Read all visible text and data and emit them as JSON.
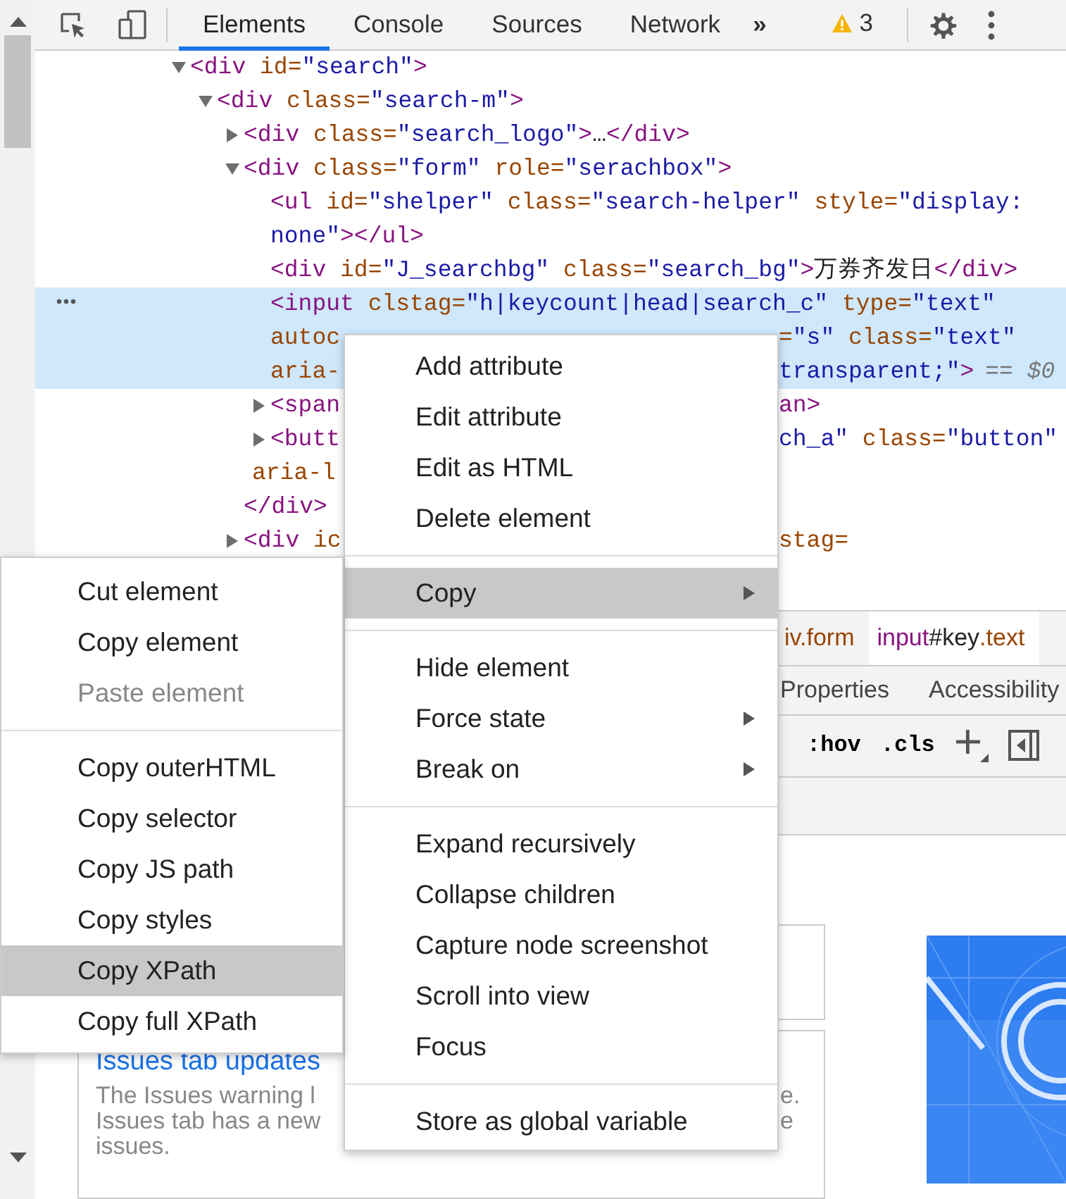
{
  "toolbar": {
    "tabs": [
      {
        "label": "Elements",
        "selected": true
      },
      {
        "label": "Console",
        "selected": false
      },
      {
        "label": "Sources",
        "selected": false
      },
      {
        "label": "Network",
        "selected": false
      }
    ],
    "overflow": "»",
    "warning_count": "3"
  },
  "dom_tree": [
    {
      "expanded": true,
      "selected": false,
      "lines": [
        [
          [
            {
              "kind": "tag",
              "text": "<div"
            },
            {
              "kind": "attr",
              "text": " id="
            },
            {
              "kind": "value",
              "text": "\"search\""
            },
            {
              "kind": "tag",
              "text": ">"
            }
          ]
        ]
      ],
      "children": [
        {
          "expanded": true,
          "selected": false,
          "lines": [
            [
              [
                {
                  "kind": "tag",
                  "text": "<div"
                },
                {
                  "kind": "attr",
                  "text": " class="
                },
                {
                  "kind": "value",
                  "text": "\"search-m\""
                },
                {
                  "kind": "tag",
                  "text": ">"
                }
              ]
            ]
          ],
          "children": [
            {
              "expanded": false,
              "selected": false,
              "lines": [
                [
                  [
                    {
                      "kind": "tag",
                      "text": "<div"
                    },
                    {
                      "kind": "attr",
                      "text": " class="
                    },
                    {
                      "kind": "value",
                      "text": "\"search_logo\""
                    },
                    {
                      "kind": "tag",
                      "text": ">"
                    },
                    {
                      "kind": "text",
                      "text": "…"
                    },
                    {
                      "kind": "tag",
                      "text": "</div>"
                    }
                  ]
                ]
              ]
            },
            {
              "expanded": true,
              "selected": false,
              "lines": [
                [
                  [
                    {
                      "kind": "tag",
                      "text": "<div"
                    },
                    {
                      "kind": "attr",
                      "text": " class="
                    },
                    {
                      "kind": "value",
                      "text": "\"form\""
                    },
                    {
                      "kind": "attr",
                      "text": " role="
                    },
                    {
                      "kind": "value",
                      "text": "\"serachbox\""
                    },
                    {
                      "kind": "tag",
                      "text": ">"
                    }
                  ]
                ]
              ],
              "closing": [
                {
                  "kind": "tag",
                  "text": "</div>"
                }
              ],
              "children": [
                {
                  "selected": false,
                  "lines": [
                    [
                      [
                        {
                          "kind": "tag",
                          "text": "<ul"
                        },
                        {
                          "kind": "attr",
                          "text": " id="
                        },
                        {
                          "kind": "value",
                          "text": "\"shelper\""
                        },
                        {
                          "kind": "attr",
                          "text": " class="
                        },
                        {
                          "kind": "value",
                          "text": "\"search-helper\""
                        },
                        {
                          "kind": "attr",
                          "text": " style="
                        },
                        {
                          "kind": "value",
                          "text": "\"display:"
                        }
                      ]
                    ],
                    [
                      [
                        {
                          "kind": "value",
                          "text": "none\""
                        },
                        {
                          "kind": "tag",
                          "text": "></ul>"
                        }
                      ]
                    ]
                  ]
                },
                {
                  "selected": false,
                  "lines": [
                    [
                      [
                        {
                          "kind": "tag",
                          "text": "<div"
                        },
                        {
                          "kind": "attr",
                          "text": " id="
                        },
                        {
                          "kind": "value",
                          "text": "\"J_searchbg\""
                        },
                        {
                          "kind": "attr",
                          "text": " class="
                        },
                        {
                          "kind": "value",
                          "text": "\"search_bg\""
                        },
                        {
                          "kind": "tag",
                          "text": ">"
                        },
                        {
                          "kind": "text",
                          "text": "万券齐发日"
                        },
                        {
                          "kind": "tag",
                          "text": "</div>"
                        }
                      ]
                    ]
                  ]
                },
                {
                  "selected": true,
                  "console_ref": "== $0",
                  "lines": [
                    [
                      [
                        {
                          "kind": "tag",
                          "text": "<input"
                        },
                        {
                          "kind": "attr",
                          "text": " clstag="
                        },
                        {
                          "kind": "value",
                          "text": "\"h|keycount|head|search_c\""
                        },
                        {
                          "kind": "attr",
                          "text": " type="
                        },
                        {
                          "kind": "value",
                          "text": "\"text\""
                        }
                      ]
                    ],
                    [
                      [
                        {
                          "kind": "attr",
                          "text": "autoc"
                        }
                      ],
                      [
                        {
                          "kind": "attr",
                          "text": "="
                        },
                        {
                          "kind": "value",
                          "text": "\"s\""
                        },
                        {
                          "kind": "attr",
                          "text": " class="
                        },
                        {
                          "kind": "value",
                          "text": "\"text\""
                        }
                      ]
                    ],
                    [
                      [
                        {
                          "kind": "attr",
                          "text": "aria-"
                        }
                      ],
                      [
                        {
                          "kind": "value",
                          "text": "transparent;\""
                        },
                        {
                          "kind": "tag",
                          "text": ">"
                        }
                      ]
                    ]
                  ]
                },
                {
                  "expanded": false,
                  "selected": false,
                  "lines": [
                    [
                      [
                        {
                          "kind": "tag",
                          "text": "<span"
                        }
                      ],
                      [
                        {
                          "kind": "tag",
                          "text": "an>"
                        }
                      ]
                    ]
                  ]
                },
                {
                  "expanded": false,
                  "selected": false,
                  "lines": [
                    [
                      [
                        {
                          "kind": "tag",
                          "text": "<butt"
                        }
                      ],
                      [
                        {
                          "kind": "value",
                          "text": "ch_a\""
                        },
                        {
                          "kind": "attr",
                          "text": " class="
                        },
                        {
                          "kind": "value",
                          "text": "\"button\""
                        }
                      ]
                    ],
                    [
                      [
                        {
                          "kind": "attr",
                          "text": "aria-l"
                        }
                      ]
                    ]
                  ]
                }
              ]
            },
            {
              "expanded": false,
              "selected": false,
              "lines": [
                [
                  [
                    {
                      "kind": "tag",
                      "text": "<div"
                    },
                    {
                      "kind": "attr",
                      "text": " ic"
                    }
                  ],
                  [
                    {
                      "kind": "attr",
                      "text": "stag="
                    }
                  ]
                ]
              ]
            }
          ]
        }
      ]
    }
  ],
  "breadcrumbs": [
    {
      "tokens": [
        {
          "kind": "class",
          "text": "iv.form"
        }
      ],
      "selected": false
    },
    {
      "tokens": [
        {
          "kind": "tag",
          "text": "input"
        },
        {
          "kind": "text",
          "text": "#key"
        },
        {
          "kind": "class",
          "text": ".text"
        }
      ],
      "selected": true
    }
  ],
  "sidebar_tabs": [
    "Properties",
    "Accessibility"
  ],
  "styles_toolbar": {
    "hov": ":hov",
    "cls": ".cls"
  },
  "issues_card": {
    "title": "Issues tab updates",
    "lines": [
      [
        "The Issues warning l",
        "e."
      ],
      [
        "Issues tab has a new",
        "e"
      ],
      [
        "issues."
      ]
    ]
  },
  "context_menu": [
    {
      "kind": "item",
      "label": "Add attribute",
      "highlighted": false,
      "has_submenu": false
    },
    {
      "kind": "item",
      "label": "Edit attribute",
      "highlighted": false,
      "has_submenu": false
    },
    {
      "kind": "item",
      "label": "Edit as HTML",
      "highlighted": false,
      "has_submenu": false
    },
    {
      "kind": "item",
      "label": "Delete element",
      "highlighted": false,
      "has_submenu": false
    },
    {
      "kind": "separator"
    },
    {
      "kind": "item",
      "label": "Copy",
      "highlighted": true,
      "has_submenu": true
    },
    {
      "kind": "separator"
    },
    {
      "kind": "item",
      "label": "Hide element",
      "highlighted": false,
      "has_submenu": false
    },
    {
      "kind": "item",
      "label": "Force state",
      "highlighted": false,
      "has_submenu": true
    },
    {
      "kind": "item",
      "label": "Break on",
      "highlighted": false,
      "has_submenu": true
    },
    {
      "kind": "separator"
    },
    {
      "kind": "item",
      "label": "Expand recursively",
      "highlighted": false,
      "has_submenu": false
    },
    {
      "kind": "item",
      "label": "Collapse children",
      "highlighted": false,
      "has_submenu": false
    },
    {
      "kind": "item",
      "label": "Capture node screenshot",
      "highlighted": false,
      "has_submenu": false
    },
    {
      "kind": "item",
      "label": "Scroll into view",
      "highlighted": false,
      "has_submenu": false
    },
    {
      "kind": "item",
      "label": "Focus",
      "highlighted": false,
      "has_submenu": false
    },
    {
      "kind": "separator"
    },
    {
      "kind": "item",
      "label": "Store as global variable",
      "highlighted": false,
      "has_submenu": false
    }
  ],
  "copy_submenu": [
    {
      "kind": "item",
      "label": "Cut element",
      "highlighted": false,
      "disabled": false
    },
    {
      "kind": "item",
      "label": "Copy element",
      "highlighted": false,
      "disabled": false
    },
    {
      "kind": "item",
      "label": "Paste element",
      "highlighted": false,
      "disabled": true
    },
    {
      "kind": "separator"
    },
    {
      "kind": "item",
      "label": "Copy outerHTML",
      "highlighted": false,
      "disabled": false
    },
    {
      "kind": "item",
      "label": "Copy selector",
      "highlighted": false,
      "disabled": false
    },
    {
      "kind": "item",
      "label": "Copy JS path",
      "highlighted": false,
      "disabled": false
    },
    {
      "kind": "item",
      "label": "Copy styles",
      "highlighted": false,
      "disabled": false
    },
    {
      "kind": "item",
      "label": "Copy XPath",
      "highlighted": true,
      "disabled": false
    },
    {
      "kind": "item",
      "label": "Copy full XPath",
      "highlighted": false,
      "disabled": false
    }
  ]
}
